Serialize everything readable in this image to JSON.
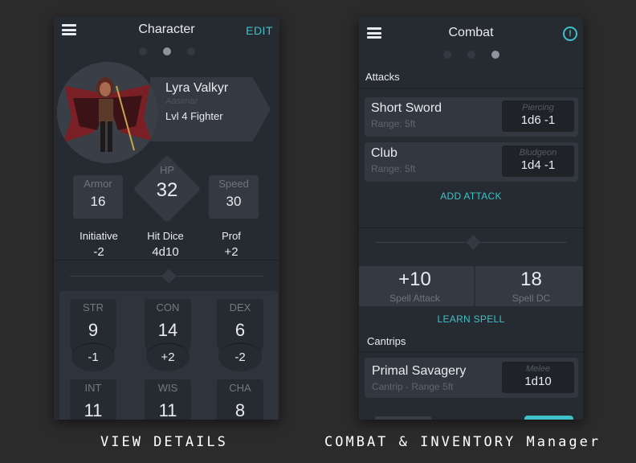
{
  "left_screen": {
    "title": "Character",
    "edit_label": "EDIT",
    "character": {
      "name": "Lyra Valkyr",
      "race": "Aasimar",
      "class_level": "Lvl 4 Fighter"
    },
    "armor": {
      "label": "Armor",
      "value": "16"
    },
    "hp": {
      "label": "HP",
      "value": "32"
    },
    "speed": {
      "label": "Speed",
      "value": "30"
    },
    "initiative": {
      "label": "Initiative",
      "value": "-2"
    },
    "hit_dice": {
      "label": "Hit Dice",
      "value": "4d10"
    },
    "prof": {
      "label": "Prof",
      "value": "+2"
    },
    "abilities": [
      {
        "label": "STR",
        "score": "9",
        "mod": "-1"
      },
      {
        "label": "CON",
        "score": "14",
        "mod": "+2"
      },
      {
        "label": "DEX",
        "score": "6",
        "mod": "-2"
      },
      {
        "label": "INT",
        "score": "11",
        "mod": ""
      },
      {
        "label": "WIS",
        "score": "11",
        "mod": ""
      },
      {
        "label": "CHA",
        "score": "8",
        "mod": ""
      }
    ]
  },
  "right_screen": {
    "title": "Combat",
    "alert_icon": "!",
    "attacks_header": "Attacks",
    "attacks": [
      {
        "name": "Short Sword",
        "range": "Range: 5ft",
        "type": "Piercing",
        "damage": "1d6 -1"
      },
      {
        "name": "Club",
        "range": "Range: 5ft",
        "type": "Bludgeon",
        "damage": "1d4 -1"
      }
    ],
    "add_attack_label": "ADD ATTACK",
    "spell_attack": {
      "value": "+10",
      "label": "Spell Attack"
    },
    "spell_dc": {
      "value": "18",
      "label": "Spell DC"
    },
    "learn_spell_label": "LEARN SPELL",
    "cantrips_header": "Cantrips",
    "cantrips": [
      {
        "name": "Primal Savagery",
        "sub": "Cantrip - Range 5ft",
        "type": "Melee",
        "damage": "1d10"
      }
    ]
  },
  "captions": {
    "left": "VIEW DETAILS",
    "right": "COMBAT & INVENTORY Manager"
  },
  "colors": {
    "accent": "#3fc1c9",
    "panel": "#262a31",
    "card": "#343942",
    "background": "#2b2b2b"
  }
}
